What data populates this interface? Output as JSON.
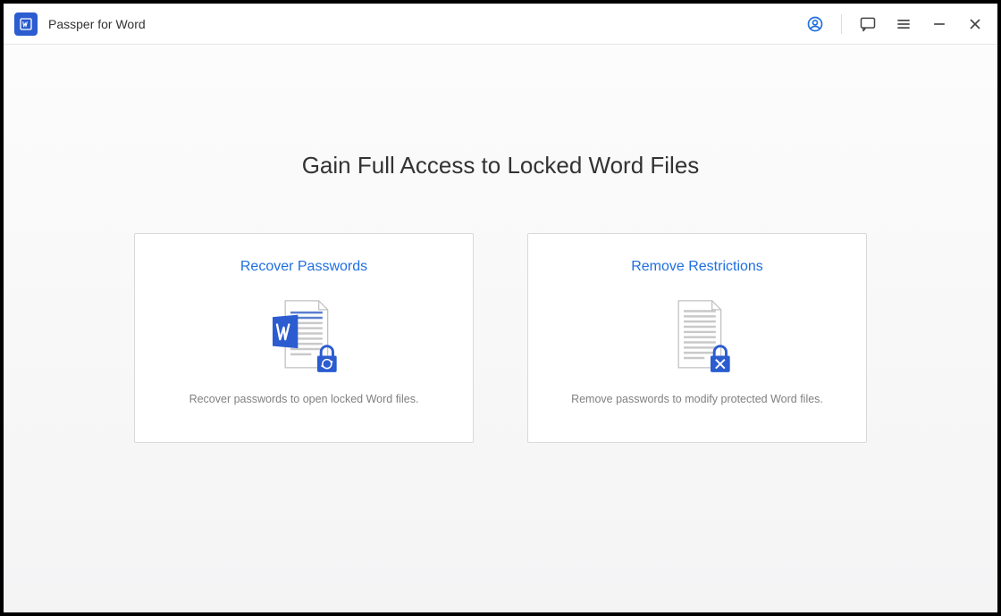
{
  "app": {
    "title": "Passper for Word"
  },
  "main": {
    "heading": "Gain Full Access to Locked Word Files",
    "cards": {
      "recover": {
        "title": "Recover Passwords",
        "desc": "Recover passwords to open locked Word files."
      },
      "remove": {
        "title": "Remove Restrictions",
        "desc": "Remove passwords to modify protected Word files."
      }
    }
  }
}
